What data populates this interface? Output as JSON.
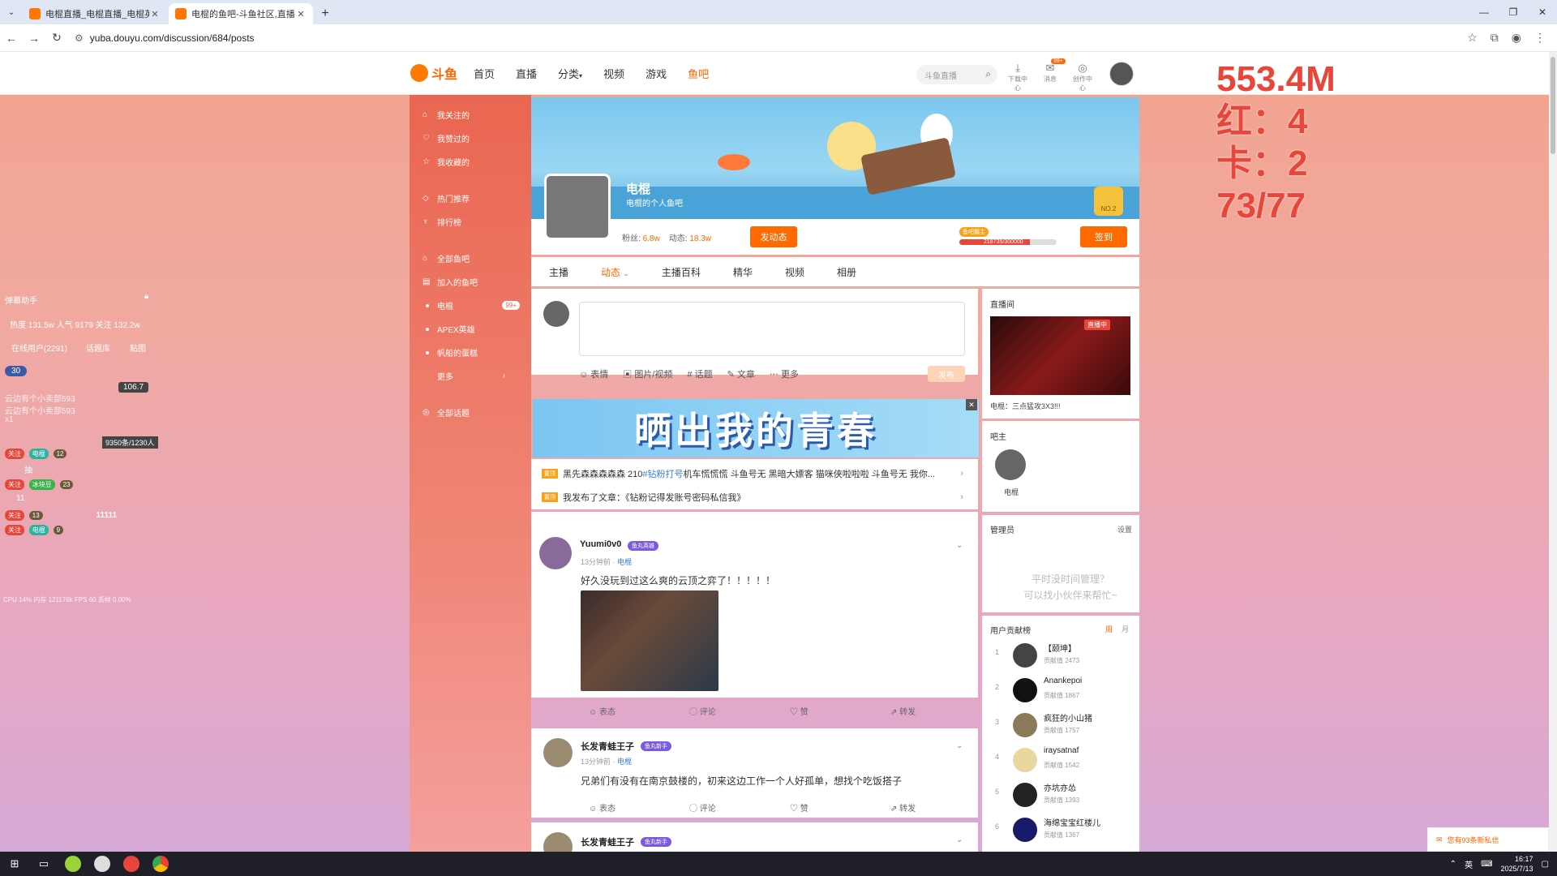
{
  "browser": {
    "tabs": [
      {
        "title": "电棍直播_电棍直播_电棍英雄联",
        "active": false
      },
      {
        "title": "电棍的鱼吧-斗鱼社区,直播精彩",
        "active": true
      }
    ],
    "url": "yuba.douyu.com/discussion/684/posts"
  },
  "header": {
    "logo_text": "斗鱼",
    "nav": [
      "首页",
      "直播",
      "分类",
      "视频",
      "游戏",
      "鱼吧"
    ],
    "search_placeholder": "斗鱼直播",
    "icons": [
      {
        "label": "下载中心",
        "icon": "download-icon"
      },
      {
        "label": "消息",
        "icon": "message-icon",
        "badge": "99+"
      },
      {
        "label": "创作中心",
        "icon": "create-icon"
      }
    ]
  },
  "left_sidebar": {
    "group1": [
      "我关注的",
      "我赞过的",
      "我收藏的"
    ],
    "group2": [
      "热门推荐",
      "排行榜"
    ],
    "group3_title": "全部鱼吧",
    "joined_title": "加入的鱼吧",
    "joined": [
      {
        "name": "电棍",
        "badge": "99+"
      },
      {
        "name": "APEX英雄"
      },
      {
        "name": "帆船的蛋糕"
      }
    ],
    "more": "更多",
    "topics": "全部话题"
  },
  "profile": {
    "name": "电棍",
    "subtitle": "电棍的个人鱼吧",
    "fans_label": "粉丝:",
    "fans_value": "6.8w",
    "posts_label": "动态:",
    "posts_value": "18.3w",
    "post_button": "发动态",
    "level_tag": "鱼吧霸主",
    "level_progress": "218735/300000",
    "level_fraction": 0.729,
    "checkin_button": "签到",
    "medal": "NO.2"
  },
  "subnav": [
    "主播",
    "动态",
    "主播百科",
    "精华",
    "视频",
    "相册"
  ],
  "composer": {
    "tools": [
      "表情",
      "图片/视频",
      "话题",
      "文章",
      "更多"
    ],
    "send": "发布"
  },
  "promo": {
    "text": "晒出我的青春"
  },
  "notices": [
    {
      "tag": "置顶",
      "text": "黑先森森森森森 210 ",
      "hash": "#钻粉打号",
      "rest": " 机车慌慌慌 斗鱼号无 黑暗大嫖客 猫咪侠啦啦啦 斗鱼号无 我你..."
    },
    {
      "tag": "置顶",
      "text": "我发布了文章：《钻粉记得发账号密码私信我》",
      "hash": "",
      "rest": ""
    }
  ],
  "posts": [
    {
      "user": "Yuumi0v0",
      "badge": "鱼丸英雄",
      "time": "13分钟前",
      "forum": "电棍",
      "text": "好久没玩到过这么爽的云顶之弈了！！！！！",
      "actions": [
        "表态",
        "评论",
        "赞",
        "转发"
      ]
    },
    {
      "user": "长发青蛙王子",
      "badge": "鱼丸新手",
      "time": "13分钟前",
      "forum": "电棍",
      "text": "兄弟们有没有在南京鼓楼的，初来这边工作一个人好孤单，想找个吃饭搭子",
      "actions": [
        "表态",
        "评论",
        "赞",
        "转发"
      ]
    },
    {
      "user": "长发青蛙王子",
      "badge": "鱼丸新手"
    }
  ],
  "right": {
    "live_title": "直播间",
    "live_badge": "直播中",
    "live_caption": "电棍：三点猛攻3X3!!!",
    "bazhu_title": "吧主",
    "bazhu_name": "电棍",
    "mgr_title": "管理员",
    "mgr_settings": "设置",
    "mgr_placeholder_1": "平时没时间管理？",
    "mgr_placeholder_2": "可以找小伙伴来帮忙~",
    "rank_title": "用户贡献榜",
    "rank_tabs": [
      "周",
      "月"
    ],
    "rank": [
      {
        "num": "1",
        "name": "【颐坤】",
        "score": "贡献值 2473"
      },
      {
        "num": "2",
        "name": "Anankepoi",
        "score": "贡献值 1867"
      },
      {
        "num": "3",
        "name": "疯狂的小山猪",
        "score": "贡献值 1757"
      },
      {
        "num": "4",
        "name": "iraysatnaf",
        "score": "贡献值 1542"
      },
      {
        "num": "5",
        "name": "亦坑亦怂",
        "score": "贡献值 1393"
      },
      {
        "num": "6",
        "name": "海绵宝宝红楼儿",
        "score": "贡献值 1367"
      }
    ]
  },
  "overlay_left": {
    "title": "弹幕助手",
    "stats": "热度 131.5w  人气 9179  关注 132.2w",
    "online": "在线用户(2291)",
    "tab2": "话题库",
    "tab3": "贴图",
    "level": "30",
    "gift_count": "106.7",
    "line1": "云边有个小卖部593",
    "line2": "云边有个小卖部593",
    "line3": "x1",
    "fans": "9350条/1230人",
    "follow": "关注",
    "chip1": "电棍",
    "chip1_lv": "12",
    "chip2": "冰块豆",
    "chip2_lv": "23",
    "user_num": "11",
    "lv13": "13",
    "lv9": "9",
    "text11111": "11111",
    "cpu": "CPU 14%  内存 121176k  FPS 60  丢帧 0.00%"
  },
  "overlay_stats": [
    "553.4M",
    "红：4",
    "卡：2",
    "73/77"
  ],
  "toast": "您有93条新私信",
  "taskbar": {
    "lang": "英",
    "time": "16:17",
    "date": "2025/7/13"
  }
}
